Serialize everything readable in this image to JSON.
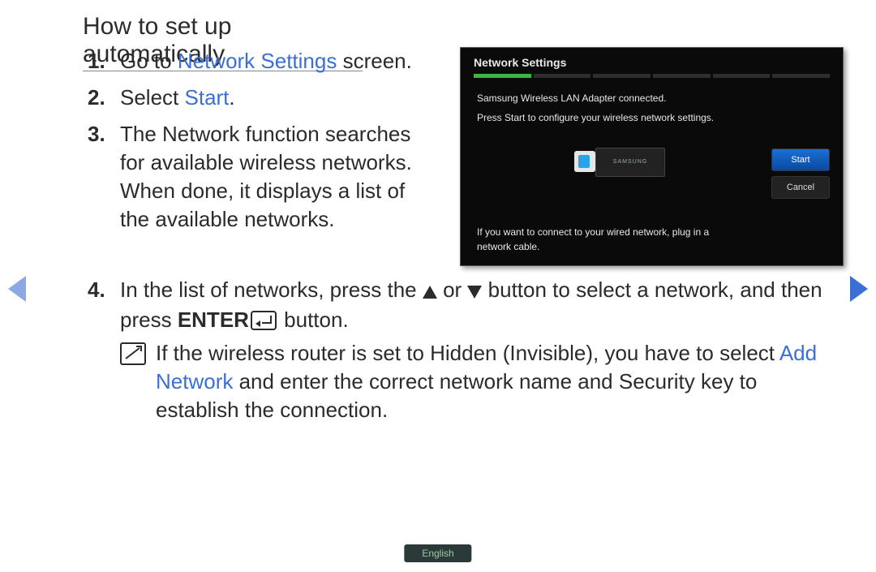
{
  "title": "How to set up automatically",
  "steps": {
    "s1": {
      "num": "1.",
      "pre": "Go to ",
      "link": "Network Settings",
      "post": " screen."
    },
    "s2": {
      "num": "2.",
      "pre": "Select ",
      "link": "Start",
      "post": "."
    },
    "s3": {
      "num": "3.",
      "text": "The Network function searches for available wireless networks. When done, it displays a list of the available networks."
    },
    "s4": {
      "num": "4.",
      "pre": "In the list of networks, press the ",
      "mid": " or ",
      "post1": " button to select a network, and then press ",
      "enter": "ENTER",
      "post2": " button."
    }
  },
  "note": {
    "pre": "If the wireless router is set to Hidden (Invisible), you have to select ",
    "link": "Add Network",
    "post": " and enter the correct network name and Security key to establish the connection."
  },
  "panel": {
    "title": "Network Settings",
    "msg1": "Samsung Wireless LAN Adapter connected.",
    "msg2": "Press Start to configure your wireless network settings.",
    "adapter_label": "SAMSUNG",
    "start": "Start",
    "cancel": "Cancel",
    "foot": "If you want to connect to your wired network, plug in a network cable."
  },
  "lang": "English"
}
